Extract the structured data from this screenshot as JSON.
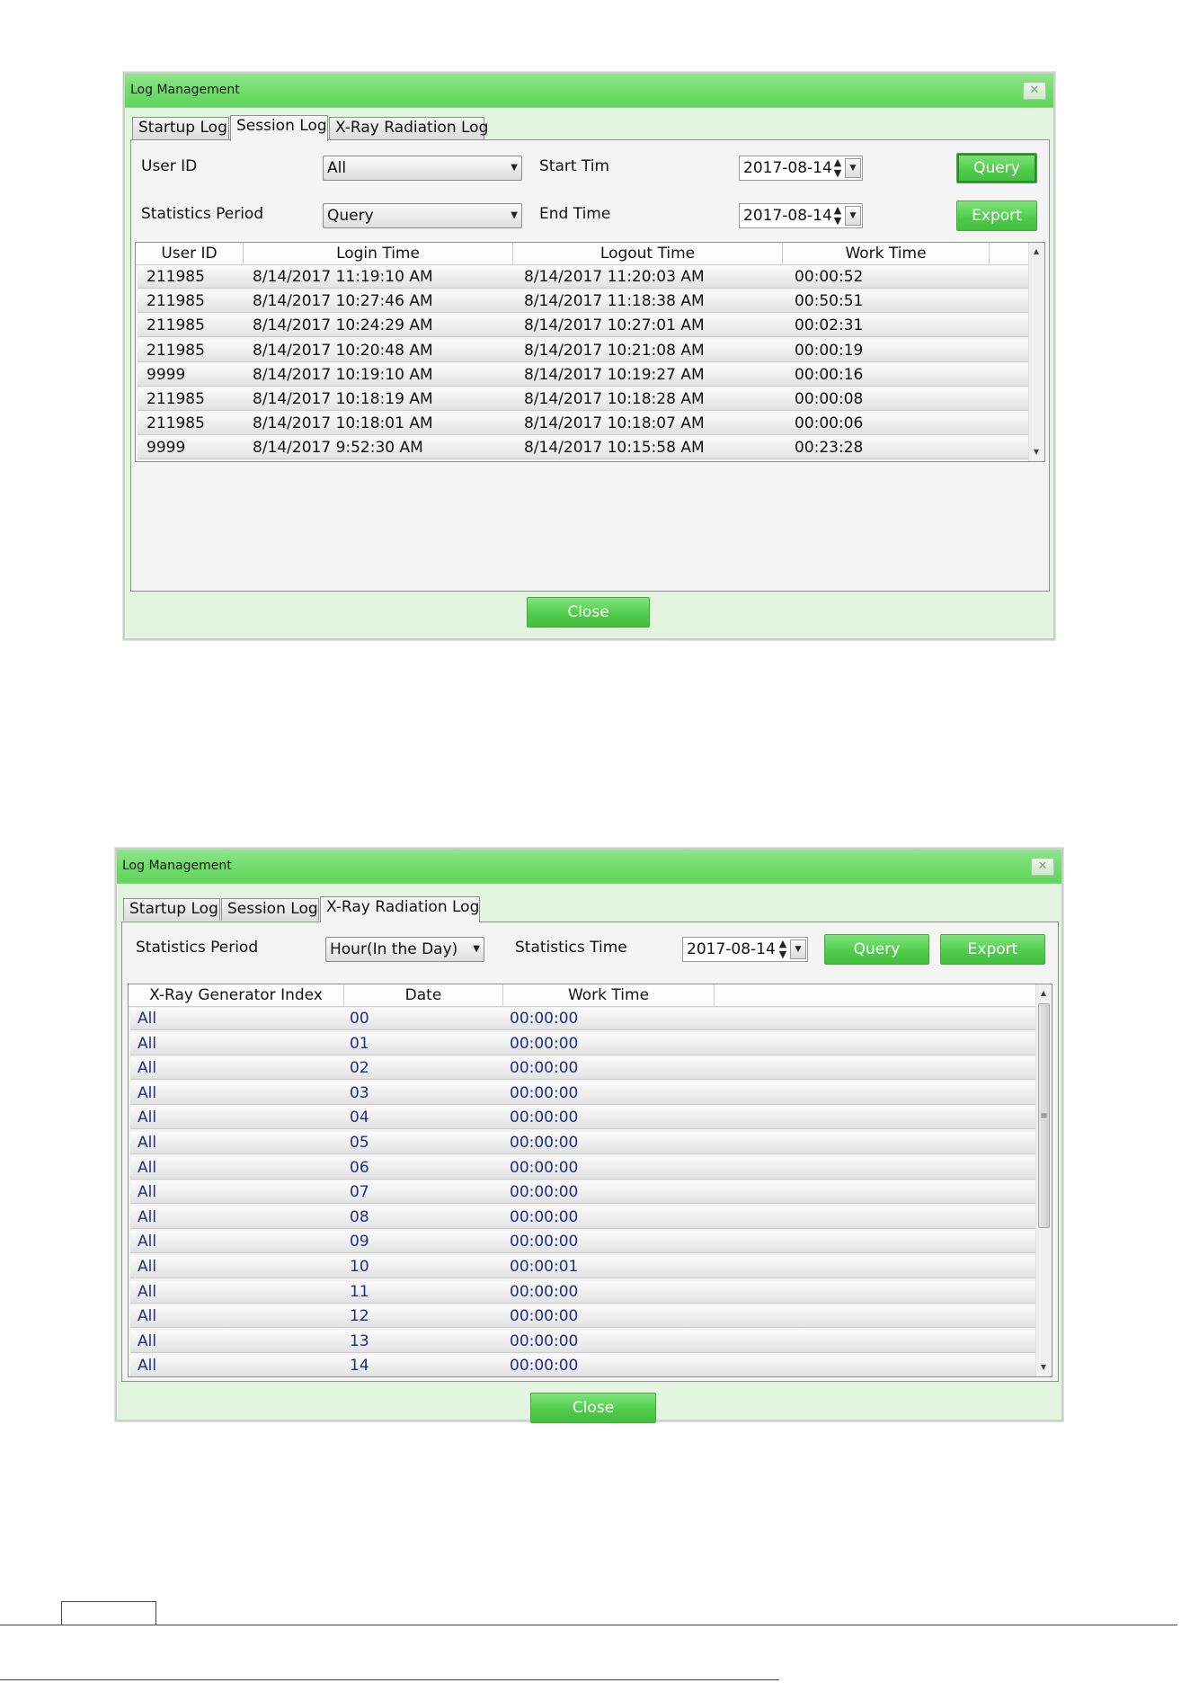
{
  "dialog1": {
    "title": "Log Management",
    "close_x": "✕",
    "tabs": [
      "Startup Log",
      "Session Log",
      "X-Ray Radiation Log"
    ],
    "active_tab": "Session Log",
    "user_id_label": "User ID",
    "user_id_value": "All",
    "period_label": "Statistics Period",
    "period_value": "Query",
    "start_label": "Start Tim",
    "start_value": "2017-08-14",
    "end_label": "End Time",
    "end_value": "2017-08-14",
    "query_label": "Query",
    "export_label": "Export",
    "columns": [
      "User ID",
      "Login Time",
      "Logout Time",
      "Work Time"
    ],
    "rows": [
      [
        "211985",
        "8/14/2017 11:19:10 AM",
        "8/14/2017 11:20:03 AM",
        "00:00:52"
      ],
      [
        "211985",
        "8/14/2017 10:27:46 AM",
        "8/14/2017 11:18:38 AM",
        "00:50:51"
      ],
      [
        "211985",
        "8/14/2017 10:24:29 AM",
        "8/14/2017 10:27:01 AM",
        "00:02:31"
      ],
      [
        "211985",
        "8/14/2017 10:20:48 AM",
        "8/14/2017 10:21:08 AM",
        "00:00:19"
      ],
      [
        "9999",
        "8/14/2017 10:19:10 AM",
        "8/14/2017 10:19:27 AM",
        "00:00:16"
      ],
      [
        "211985",
        "8/14/2017 10:18:19 AM",
        "8/14/2017 10:18:28 AM",
        "00:00:08"
      ],
      [
        "211985",
        "8/14/2017 10:18:01 AM",
        "8/14/2017 10:18:07 AM",
        "00:00:06"
      ],
      [
        "9999",
        "8/14/2017 9:52:30 AM",
        "8/14/2017 10:15:58 AM",
        "00:23:28"
      ]
    ],
    "close_label": "Close"
  },
  "dialog2": {
    "title": "Log Management",
    "close_x": "✕",
    "tabs": [
      "Startup Log",
      "Session Log",
      "X-Ray Radiation Log"
    ],
    "active_tab": "X-Ray Radiation Log",
    "period_label": "Statistics Period",
    "period_value": "Hour(In the Day)",
    "stat_time_label": "Statistics Time",
    "stat_time_value": "2017-08-14",
    "query_label": "Query",
    "export_label": "Export",
    "columns": [
      "X-Ray Generator Index",
      "Date",
      "Work Time"
    ],
    "rows": [
      [
        "All",
        "00",
        "00:00:00"
      ],
      [
        "All",
        "01",
        "00:00:00"
      ],
      [
        "All",
        "02",
        "00:00:00"
      ],
      [
        "All",
        "03",
        "00:00:00"
      ],
      [
        "All",
        "04",
        "00:00:00"
      ],
      [
        "All",
        "05",
        "00:00:00"
      ],
      [
        "All",
        "06",
        "00:00:00"
      ],
      [
        "All",
        "07",
        "00:00:00"
      ],
      [
        "All",
        "08",
        "00:00:00"
      ],
      [
        "All",
        "09",
        "00:00:00"
      ],
      [
        "All",
        "10",
        "00:00:01"
      ],
      [
        "All",
        "11",
        "00:00:00"
      ],
      [
        "All",
        "12",
        "00:00:00"
      ],
      [
        "All",
        "13",
        "00:00:00"
      ],
      [
        "All",
        "14",
        "00:00:00"
      ]
    ],
    "close_label": "Close"
  },
  "colors": {
    "title_green": "#6fdc6a",
    "button_green": "#4fc94a",
    "dialog_bg": "#e3f5e0",
    "panel_bg": "#f4f4f4",
    "radiation_text": "#1d2f86"
  }
}
